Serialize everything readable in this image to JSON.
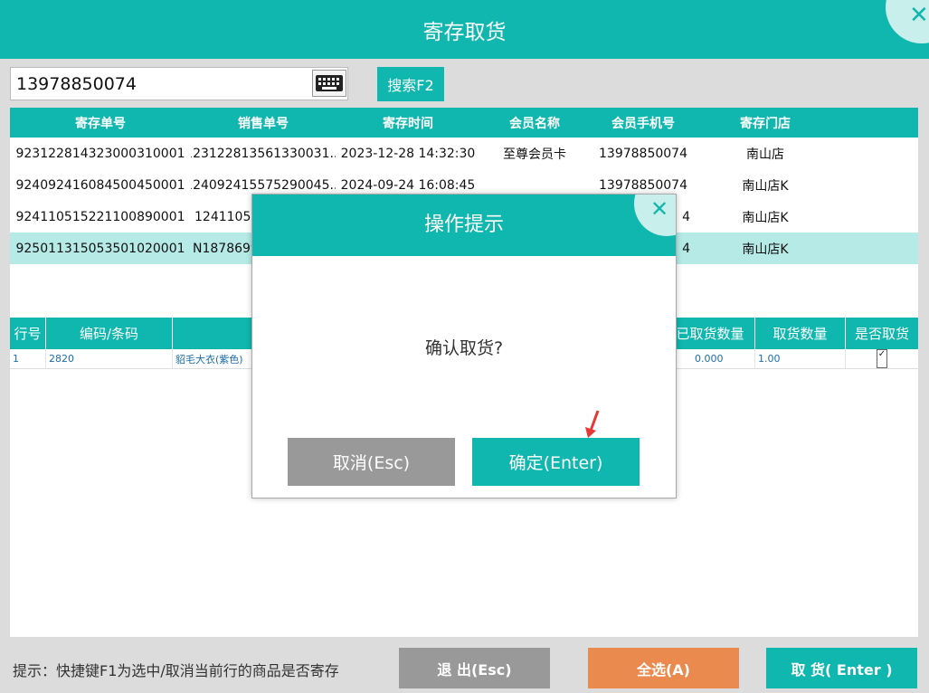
{
  "window": {
    "title": "寄存取货",
    "close_label": "✕"
  },
  "search": {
    "value": "13978850074",
    "button_label": "搜索F2"
  },
  "upper_table": {
    "headers": [
      "寄存单号",
      "销售单号",
      "寄存时间",
      "会员名称",
      "会员手机号",
      "寄存门店"
    ],
    "rows": [
      [
        "923122814323000310001",
        "123122813561330031...",
        "2023-12-28 14:32:30",
        "至尊会员卡",
        "13978850074",
        "南山店"
      ],
      [
        "924092416084500450001",
        "124092415575290045...",
        "2024-09-24 16:08:45",
        "",
        "13978850074",
        "南山店K"
      ],
      [
        "924110515221100890001",
        "12411051",
        "",
        "",
        "4",
        "南山店K"
      ],
      [
        "925011315053501020001",
        "N1878699",
        "",
        "",
        "4",
        "南山店K"
      ]
    ],
    "selected_index": 3
  },
  "lower_table": {
    "headers": [
      "行号",
      "编码/条码",
      "",
      "已取货数量",
      "取货数量",
      "是否取货"
    ],
    "rows": [
      {
        "line": "1",
        "code": "2820",
        "name": "貂毛大衣(紫色)",
        "picked": "0.000",
        "qty": "1.00",
        "checked": "✓"
      }
    ]
  },
  "footer": {
    "hint": "提示：快捷键F1为选中/取消当前行的商品是否寄存",
    "exit_label": "退 出(Esc)",
    "select_all_label": "全选(A)",
    "pickup_label": "取 货( Enter )"
  },
  "dialog": {
    "title": "操作提示",
    "message": "确认取货?",
    "cancel_label": "取消(Esc)",
    "confirm_label": "确定(Enter)",
    "close_label": "✕"
  },
  "colors": {
    "accent": "#10b7ae",
    "gray_button": "#999999",
    "orange_button": "#ea8a4f",
    "selected_row": "#b5eae7"
  }
}
